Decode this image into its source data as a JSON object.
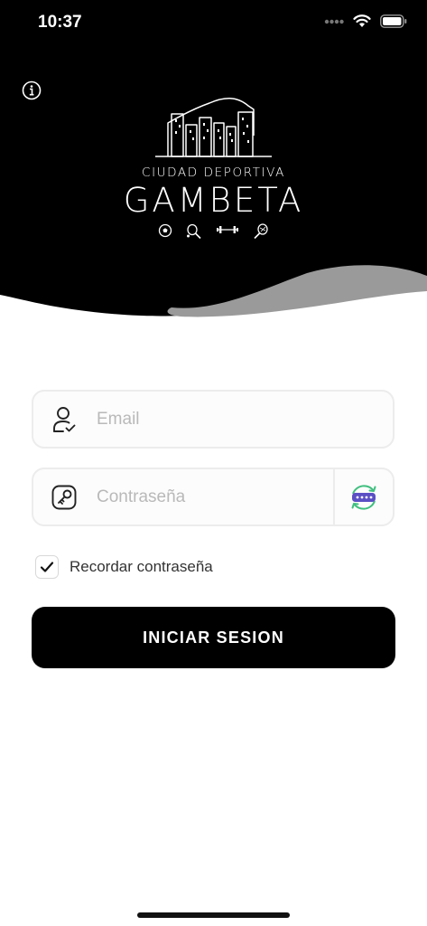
{
  "status_bar": {
    "time": "10:37"
  },
  "brand": {
    "subtitle": "CIUDAD DEPORTIVA",
    "title": "GAMBETA"
  },
  "form": {
    "email_placeholder": "Email",
    "password_placeholder": "Contraseña",
    "remember_label": "Recordar contraseña",
    "remember_checked": true,
    "login_label": "INICIAR SESION"
  },
  "colors": {
    "header_bg": "#000000",
    "wave": "#9a9a9a",
    "button_bg": "#000000",
    "password_toggle_accent": "#5b4fc4",
    "password_toggle_ring": "#3fbf7f"
  },
  "icons": [
    "signal-dots-icon",
    "wifi-icon",
    "battery-icon",
    "info-icon",
    "soccer-ball-icon",
    "padel-icon",
    "dumbbell-icon",
    "tennis-icon",
    "user-check-icon",
    "key-icon",
    "password-toggle-icon",
    "check-icon"
  ]
}
